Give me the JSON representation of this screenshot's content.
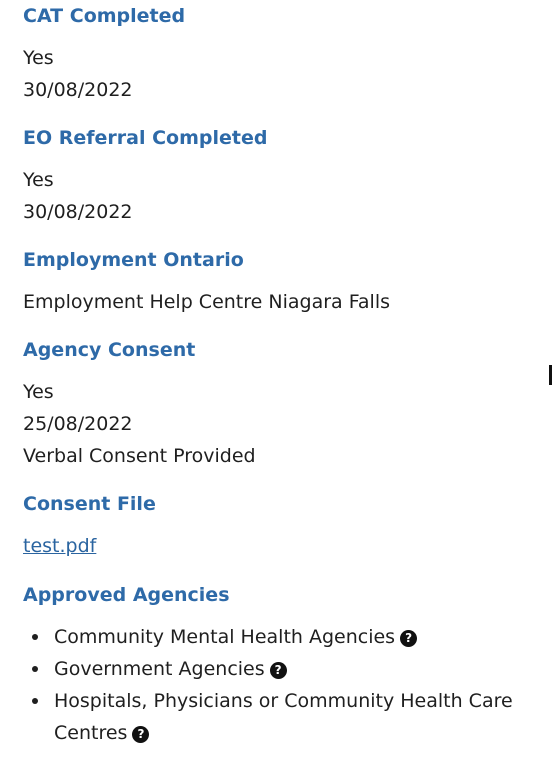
{
  "sections": {
    "cat": {
      "title": "CAT Completed",
      "answer": "Yes",
      "date": "30/08/2022"
    },
    "eo": {
      "title": "EO Referral Completed",
      "answer": "Yes",
      "date": "30/08/2022"
    },
    "employment": {
      "title": "Employment Ontario",
      "value": "Employment Help Centre Niagara Falls"
    },
    "consent": {
      "title": "Agency Consent",
      "answer": "Yes",
      "date": "25/08/2022",
      "type": "Verbal Consent Provided"
    },
    "file": {
      "title": "Consent File",
      "link": "test.pdf"
    },
    "agencies": {
      "title": "Approved Agencies",
      "items": [
        "Community Mental Health Agencies",
        "Government Agencies",
        "Hospitals, Physicians or Community Health Care Centres"
      ],
      "help_glyph": "?"
    }
  },
  "icons": {
    "bullet": "disc-bullet-icon",
    "help": "question-circle-icon",
    "edge": "text-cursor-icon"
  },
  "colors": {
    "heading": "#2e6aa8",
    "link": "#2a64a0",
    "text": "#1f1f1f"
  }
}
